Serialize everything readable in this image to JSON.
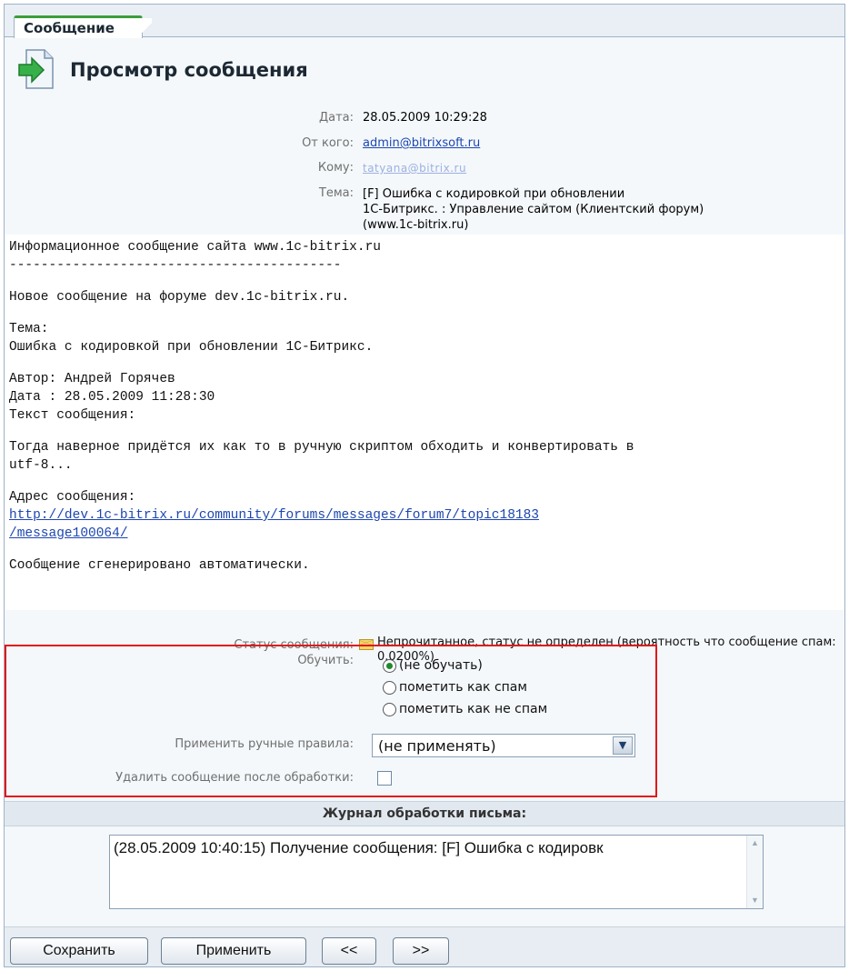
{
  "tab": {
    "label": "Сообщение"
  },
  "title": "Просмотр сообщения",
  "header_fields": {
    "date_label": "Дата:",
    "date_value": "28.05.2009 10:29:28",
    "from_label": "От кого:",
    "from_value": "admin@bitrixsoft.ru",
    "to_label": "Кому:",
    "to_value": "tatyana@bitrix.ru",
    "subject_label": "Тема:",
    "subject_lines": [
      "[F] Ошибка с кодировкой при обновлении",
      "1С-Битрикс. : Управление сайтом (Клиентский форум)",
      "(www.1c-bitrix.ru)"
    ]
  },
  "body": {
    "lines": [
      "Информационное сообщение сайта www.1c-bitrix.ru",
      "------------------------------------------",
      "",
      "Новое сообщение на форуме dev.1c-bitrix.ru.",
      "",
      "Тема:",
      "Ошибка с кодировкой при обновлении 1С-Битрикс.",
      "",
      "Автор: Андрей Горячев",
      "Дата : 28.05.2009 11:28:30",
      "Текст сообщения:",
      "",
      "Тогда наверное придётся их как то в ручную скриптом обходить и конвертировать в",
      "utf-8...",
      "",
      "Адрес сообщения:"
    ],
    "link_lines": [
      "http://dev.1c-bitrix.ru/community/forums/messages/forum7/topic18183",
      "/message100064/"
    ],
    "closing": "Сообщение сгенерировано автоматически."
  },
  "status": {
    "label": "Статус сообщения:",
    "icon": "envelope-icon",
    "text": "Непрочитанное, статус не определен (вероятность что сообщение спам: 0.0200%)"
  },
  "training": {
    "label": "Обучить:",
    "options": [
      "(не обучать)",
      "пометить как спам",
      "пометить как не спам"
    ],
    "selected_index": 0,
    "rules_label": "Применить ручные правила:",
    "rules_value": "(не применять)",
    "delete_label": "Удалить сообщение после обработки:",
    "delete_checked": false
  },
  "journal": {
    "header": "Журнал обработки письма:",
    "text": "(28.05.2009 10:40:15) Получение сообщения: [F] Ошибка с кодировк"
  },
  "buttons": {
    "save": "Сохранить",
    "apply": "Применить",
    "prev": "<<",
    "next": ">>"
  },
  "colors": {
    "accent_green": "#3c9e3a",
    "link_blue": "#1d46b0",
    "highlight_red": "#e21818"
  }
}
